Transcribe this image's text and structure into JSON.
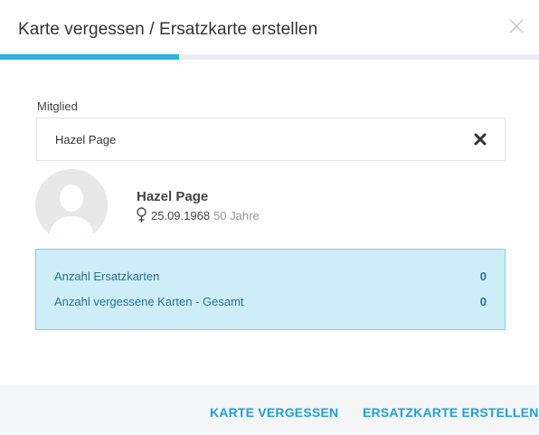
{
  "dialog": {
    "title": "Karte vergessen / Ersatzkarte erstellen",
    "progress": 0.333,
    "progress_color": "#2bb3e3",
    "close_icon": "close-icon"
  },
  "member_field": {
    "label": "Mitglied",
    "value": "Hazel Page",
    "clear_icon": "clear-x-icon"
  },
  "profile": {
    "name": "Hazel Page",
    "gender_icon": "female-symbol-icon",
    "birthdate": "25.09.1968",
    "age": "50 Jahre",
    "avatar_icon": "avatar-placeholder-icon"
  },
  "stats": {
    "replacement_cards_label": "Anzahl Ersatzkarten",
    "replacement_cards_value": "0",
    "forgotten_cards_label": "Anzahl vergessene Karten - Gesamt",
    "forgotten_cards_value": "0"
  },
  "footer": {
    "forget_card_label": "KARTE VERGESSEN",
    "create_replacement_label": "ERSATZKARTE ERSTELLEN",
    "accent_color": "#1f9fd8"
  }
}
